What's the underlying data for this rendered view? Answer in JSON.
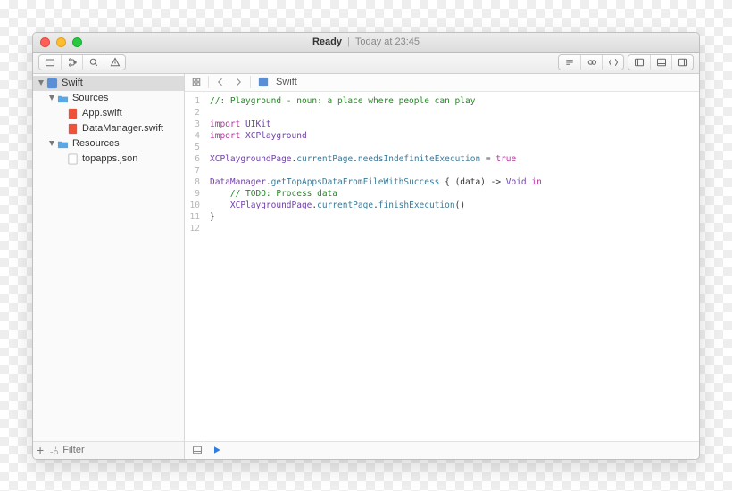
{
  "window": {
    "title_status": "Ready",
    "title_separator": "|",
    "title_timestamp": "Today at 23:45"
  },
  "toolbar": {
    "left_icons": [
      "folder-nav-icon",
      "hierarchy-icon",
      "search-icon",
      "warning-icon"
    ],
    "right_group1": [
      "toggle-assistant-icon",
      "link-icon",
      "refresh-icon"
    ],
    "right_group2": [
      "panel-left-icon",
      "panel-bottom-icon",
      "panel-right-icon"
    ]
  },
  "navigator": {
    "root": {
      "label": "Swift",
      "expanded": true,
      "kind": "playground"
    },
    "groups": [
      {
        "label": "Sources",
        "expanded": true,
        "kind": "folder",
        "children": [
          {
            "label": "App.swift",
            "kind": "swift"
          },
          {
            "label": "DataManager.swift",
            "kind": "swift"
          }
        ]
      },
      {
        "label": "Resources",
        "expanded": true,
        "kind": "folder",
        "children": [
          {
            "label": "topapps.json",
            "kind": "json"
          }
        ]
      }
    ]
  },
  "footer": {
    "filter_placeholder": "Filter"
  },
  "jumpbar": {
    "crumb": "Swift"
  },
  "code": {
    "lines": [
      {
        "n": 1,
        "spans": [
          {
            "cls": "c-comment",
            "t": "//: Playground - noun: a place where people can play"
          }
        ]
      },
      {
        "n": 2,
        "spans": [
          {
            "cls": "",
            "t": ""
          }
        ]
      },
      {
        "n": 3,
        "spans": [
          {
            "cls": "c-keyword",
            "t": "import "
          },
          {
            "cls": "c-type",
            "t": "UIKit"
          }
        ]
      },
      {
        "n": 4,
        "spans": [
          {
            "cls": "c-keyword",
            "t": "import "
          },
          {
            "cls": "c-type",
            "t": "XCPlayground"
          }
        ]
      },
      {
        "n": 5,
        "spans": [
          {
            "cls": "",
            "t": ""
          }
        ]
      },
      {
        "n": 6,
        "spans": [
          {
            "cls": "c-type",
            "t": "XCPlaygroundPage"
          },
          {
            "cls": "",
            "t": "."
          },
          {
            "cls": "c-prop",
            "t": "currentPage"
          },
          {
            "cls": "",
            "t": "."
          },
          {
            "cls": "c-prop",
            "t": "needsIndefiniteExecution"
          },
          {
            "cls": "",
            "t": " = "
          },
          {
            "cls": "c-bool",
            "t": "true"
          }
        ]
      },
      {
        "n": 7,
        "spans": [
          {
            "cls": "",
            "t": ""
          }
        ]
      },
      {
        "n": 8,
        "spans": [
          {
            "cls": "c-type",
            "t": "DataManager"
          },
          {
            "cls": "",
            "t": "."
          },
          {
            "cls": "c-func",
            "t": "getTopAppsDataFromFileWithSuccess"
          },
          {
            "cls": "",
            "t": " { (data) -> "
          },
          {
            "cls": "c-type",
            "t": "Void"
          },
          {
            "cls": "c-keyword",
            "t": " in"
          }
        ]
      },
      {
        "n": 9,
        "spans": [
          {
            "cls": "",
            "t": "    "
          },
          {
            "cls": "c-comment",
            "t": "// TODO: Process data"
          }
        ]
      },
      {
        "n": 10,
        "spans": [
          {
            "cls": "",
            "t": "    "
          },
          {
            "cls": "c-type",
            "t": "XCPlaygroundPage"
          },
          {
            "cls": "",
            "t": "."
          },
          {
            "cls": "c-prop",
            "t": "currentPage"
          },
          {
            "cls": "",
            "t": "."
          },
          {
            "cls": "c-func",
            "t": "finishExecution"
          },
          {
            "cls": "",
            "t": "()"
          }
        ]
      },
      {
        "n": 11,
        "spans": [
          {
            "cls": "",
            "t": "}"
          }
        ]
      },
      {
        "n": 12,
        "spans": [
          {
            "cls": "",
            "t": ""
          }
        ]
      }
    ]
  }
}
